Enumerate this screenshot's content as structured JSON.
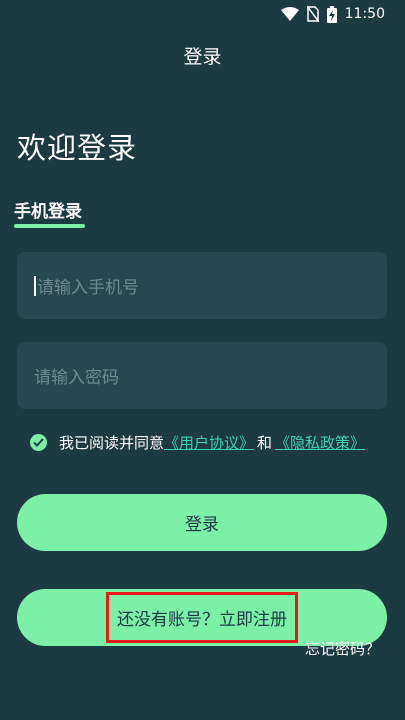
{
  "status_bar": {
    "time": "11:50",
    "icons": [
      "wifi-icon",
      "no-sim-icon",
      "battery-charging-icon"
    ]
  },
  "header": {
    "title": "登录"
  },
  "welcome": "欢迎登录",
  "tab": {
    "label": "手机登录"
  },
  "phone_input": {
    "placeholder": "请输入手机号"
  },
  "password_input": {
    "placeholder": "请输入密码"
  },
  "agreement": {
    "checked": true,
    "prefix": "我已阅读并同意",
    "user_agreement": "《用户协议》",
    "and": "和",
    "privacy_policy": "《隐私政策》"
  },
  "login_button": "登录",
  "register_button": "还没有账号？立即注册",
  "forgot_password": "忘记密码？",
  "colors": {
    "background": "#1b3a42",
    "accent": "#7cf0a6",
    "field": "#274850",
    "link": "#3fd0b0",
    "highlight": "#e8191b"
  }
}
